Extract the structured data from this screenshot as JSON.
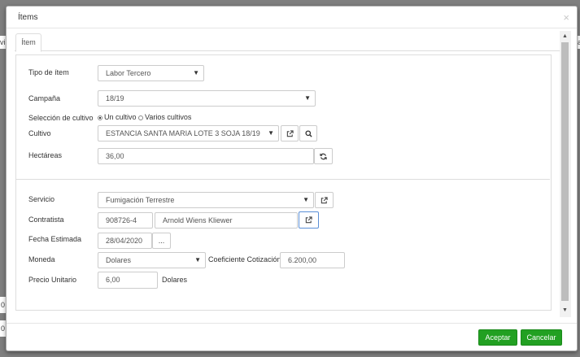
{
  "background": {
    "frag_left_a": "vi",
    "frag_left_b": "0",
    "frag_left_c": "0",
    "frag_right_a": "ia"
  },
  "modal": {
    "title": "Ítems",
    "close_glyph": "×"
  },
  "tabs": [
    {
      "label": "Ítem"
    }
  ],
  "form": {
    "tipo_item": {
      "label": "Tipo de ítem",
      "value": "Labor Tercero"
    },
    "campana": {
      "label": "Campaña",
      "value": "18/19"
    },
    "seleccion_cultivo": {
      "label": "Selección de cultivo",
      "options": [
        "Un cultivo",
        "Varios cultivos"
      ],
      "selected": "Un cultivo"
    },
    "cultivo": {
      "label": "Cultivo",
      "value": "ESTANCIA SANTA MARIA LOTE 3 SOJA 18/19"
    },
    "hectareas": {
      "label": "Hectáreas",
      "value": "36,00"
    },
    "servicio": {
      "label": "Servicio",
      "value": "Fumigación Terrestre"
    },
    "contratista": {
      "label": "Contratista",
      "code": "908726-4",
      "name": "Arnold Wiens Kliewer"
    },
    "fecha_estimada": {
      "label": "Fecha Estimada",
      "value": "28/04/2020",
      "picker_label": "..."
    },
    "moneda": {
      "label": "Moneda",
      "value": "Dolares"
    },
    "coeficiente": {
      "label": "Coeficiente Cotización",
      "value": "6.200,00"
    },
    "precio_unitario": {
      "label": "Precio Unitario",
      "value": "6,00",
      "unit": "Dolares"
    }
  },
  "actions": {
    "accept": "Aceptar",
    "cancel": "Cancelar"
  },
  "colors": {
    "accent_green": "#22a022",
    "border": "#cccccc",
    "focus_border": "#5b8fd6"
  }
}
